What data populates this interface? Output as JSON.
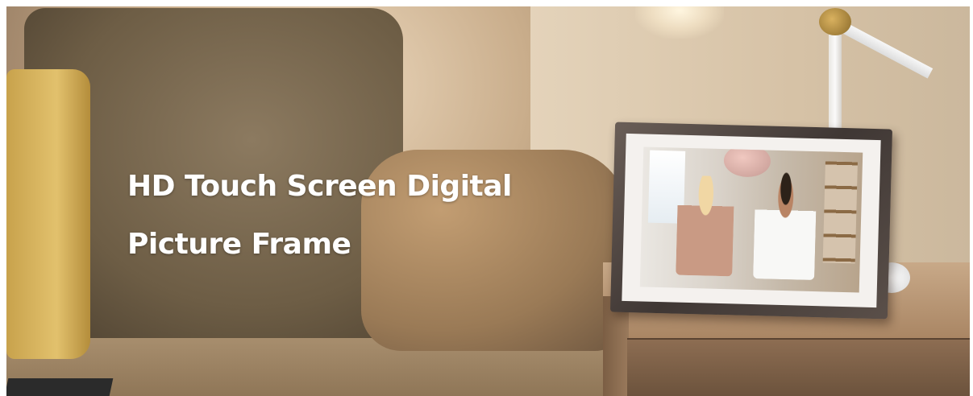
{
  "hero": {
    "headline_line1": "HD Touch Screen Digital",
    "headline_line2": "Picture Frame"
  }
}
